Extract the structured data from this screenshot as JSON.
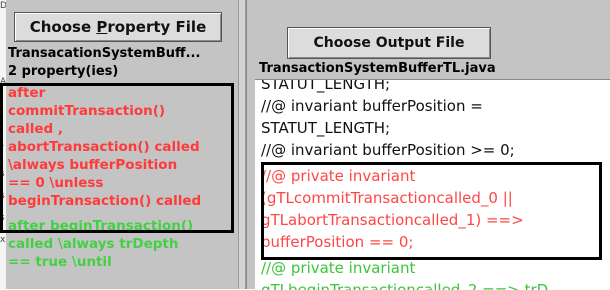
{
  "left_panel": {
    "button_label": "Choose Property File",
    "button_mnemonic_index": 7,
    "file_name": "TransacationSystemBuff...",
    "property_count": "2 property(ies)",
    "properties": [
      {
        "text": "after",
        "color": "red"
      },
      {
        "text": "commitTransaction()",
        "color": "red"
      },
      {
        "text": "called ,",
        "color": "red"
      },
      {
        "text": "abortTransaction() called",
        "color": "red"
      },
      {
        "text": "\\always bufferPosition",
        "color": "red"
      },
      {
        "text": "== 0 \\unless",
        "color": "red"
      },
      {
        "text": "beginTransaction() called",
        "color": "red"
      },
      {
        "text": "after beginTransaction()",
        "color": "green"
      },
      {
        "text": "called \\always trDepth",
        "color": "green"
      },
      {
        "text": "== true \\until",
        "color": "green"
      }
    ]
  },
  "right_panel": {
    "button_label": "Choose Output File",
    "file_name": "TransactionSystemBufferTL.java",
    "code_lines": [
      {
        "text": "STATUT_LENGTH;",
        "color": "black"
      },
      {
        "text": "//@ invariant bufferPosition =",
        "color": "black"
      },
      {
        "text": "STATUT_LENGTH;",
        "color": "black"
      },
      {
        "text": "//@ invariant bufferPosition >= 0;",
        "color": "black"
      },
      {
        "text": "//@ private invariant",
        "color": "red"
      },
      {
        "text": "(gTLcommitTransactioncalled_0 ||",
        "color": "red"
      },
      {
        "text": "gTLabortTransactioncalled_1) ==>",
        "color": "red"
      },
      {
        "text": "bufferPosition == 0;",
        "color": "red"
      },
      {
        "text": "//@ private invariant",
        "color": "green"
      },
      {
        "text": "gTLbeginTransactioncalled_2 ==> trD",
        "color": "green"
      }
    ]
  },
  "left_edge_glyphs": [
    "D",
    "A",
    "r",
    "s",
    "s",
    "s",
    "x"
  ],
  "colors": {
    "red": "#ff3a3a",
    "green": "#44d044",
    "panel_bg": "#c4c4c4",
    "code_bg": "#ffffff"
  }
}
